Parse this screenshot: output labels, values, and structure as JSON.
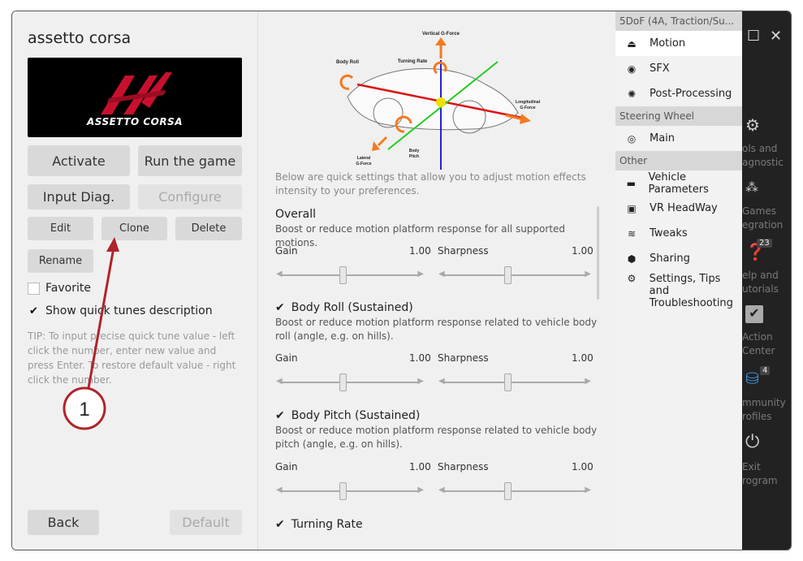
{
  "app": {
    "title": "assetto corsa",
    "logo_text": "ASSETTO CORSA"
  },
  "buttons": {
    "activate": "Activate",
    "run": "Run the game",
    "input_diag": "Input Diag.",
    "configure": "Configure",
    "edit": "Edit",
    "clone": "Clone",
    "delete": "Delete",
    "rename": "Rename",
    "back": "Back",
    "default": "Default"
  },
  "options": {
    "favorite": "Favorite",
    "show_quick": "Show quick tunes description"
  },
  "tip": "TIP: To input precise quick tune value - left click the number, enter new value and press Enter. To restore default value - right click the number.",
  "diagram": {
    "vertical": "Vertical G-Force",
    "turning": "Turning Rate",
    "roll": "Body Roll",
    "longitudinal_1": "Longitudinal",
    "longitudinal_2": "G-Force",
    "lateral_1": "Lateral",
    "lateral_2": "G-Force",
    "pitch_1": "Body",
    "pitch_2": "Pitch"
  },
  "intro": "Below are quick settings that allow you to adjust motion effects intensity to your preferences.",
  "sections": [
    {
      "title": "Overall",
      "desc": "Boost or reduce motion platform response for all supported motions.",
      "gain_label": "Gain",
      "gain": "1.00",
      "sharp_label": "Sharpness",
      "sharp": "1.00",
      "gain_level": 0.45,
      "sharp_level": 0.45
    },
    {
      "title": "Body Roll (Sustained)",
      "desc": "Boost or reduce motion platform response related to vehicle body roll (angle, e.g. on hills).",
      "gain_label": "Gain",
      "gain": "1.00",
      "sharp_label": "Sharpness",
      "sharp": "1.00",
      "gain_level": 0.45,
      "sharp_level": 0.45
    },
    {
      "title": "Body Pitch (Sustained)",
      "desc": "Boost or reduce motion platform response related to vehicle body pitch (angle, e.g. on hills).",
      "gain_label": "Gain",
      "gain": "1.00",
      "sharp_label": "Sharpness",
      "sharp": "1.00",
      "gain_level": 0.45,
      "sharp_level": 0.45
    },
    {
      "title": "Turning Rate"
    }
  ],
  "menu": {
    "cat1": "5DoF (4A, Traction/Su...",
    "motion": "Motion",
    "sfx": "SFX",
    "post": "Post-Processing",
    "cat2": "Steering Wheel",
    "main": "Main",
    "cat3": "Other",
    "vehicle": "Vehicle Parameters",
    "vr": "VR HeadWay",
    "tweaks": "Tweaks",
    "sharing": "Sharing",
    "settings_1": "Settings, Tips and",
    "settings_2": "Troubleshooting"
  },
  "sidebar_dark": {
    "tools_1": "ols and",
    "tools_2": "agnostic",
    "games_1": "Games",
    "games_2": "egration",
    "help_1": "elp and",
    "help_2": "utorials",
    "help_badge": "23",
    "action_1": "Action",
    "action_2": "Center",
    "community_1": "mmunity",
    "community_2": "rofiles",
    "community_badge": "4",
    "exit_1": "Exit",
    "exit_2": "rogram"
  },
  "annotation": {
    "marker": "1"
  },
  "colors": {
    "accent_red": "#b0232a",
    "arrow_orange": "#f47a20",
    "axis_green": "#22cc22",
    "axis_blue": "#2222dd",
    "axis_red": "#dd1111"
  }
}
